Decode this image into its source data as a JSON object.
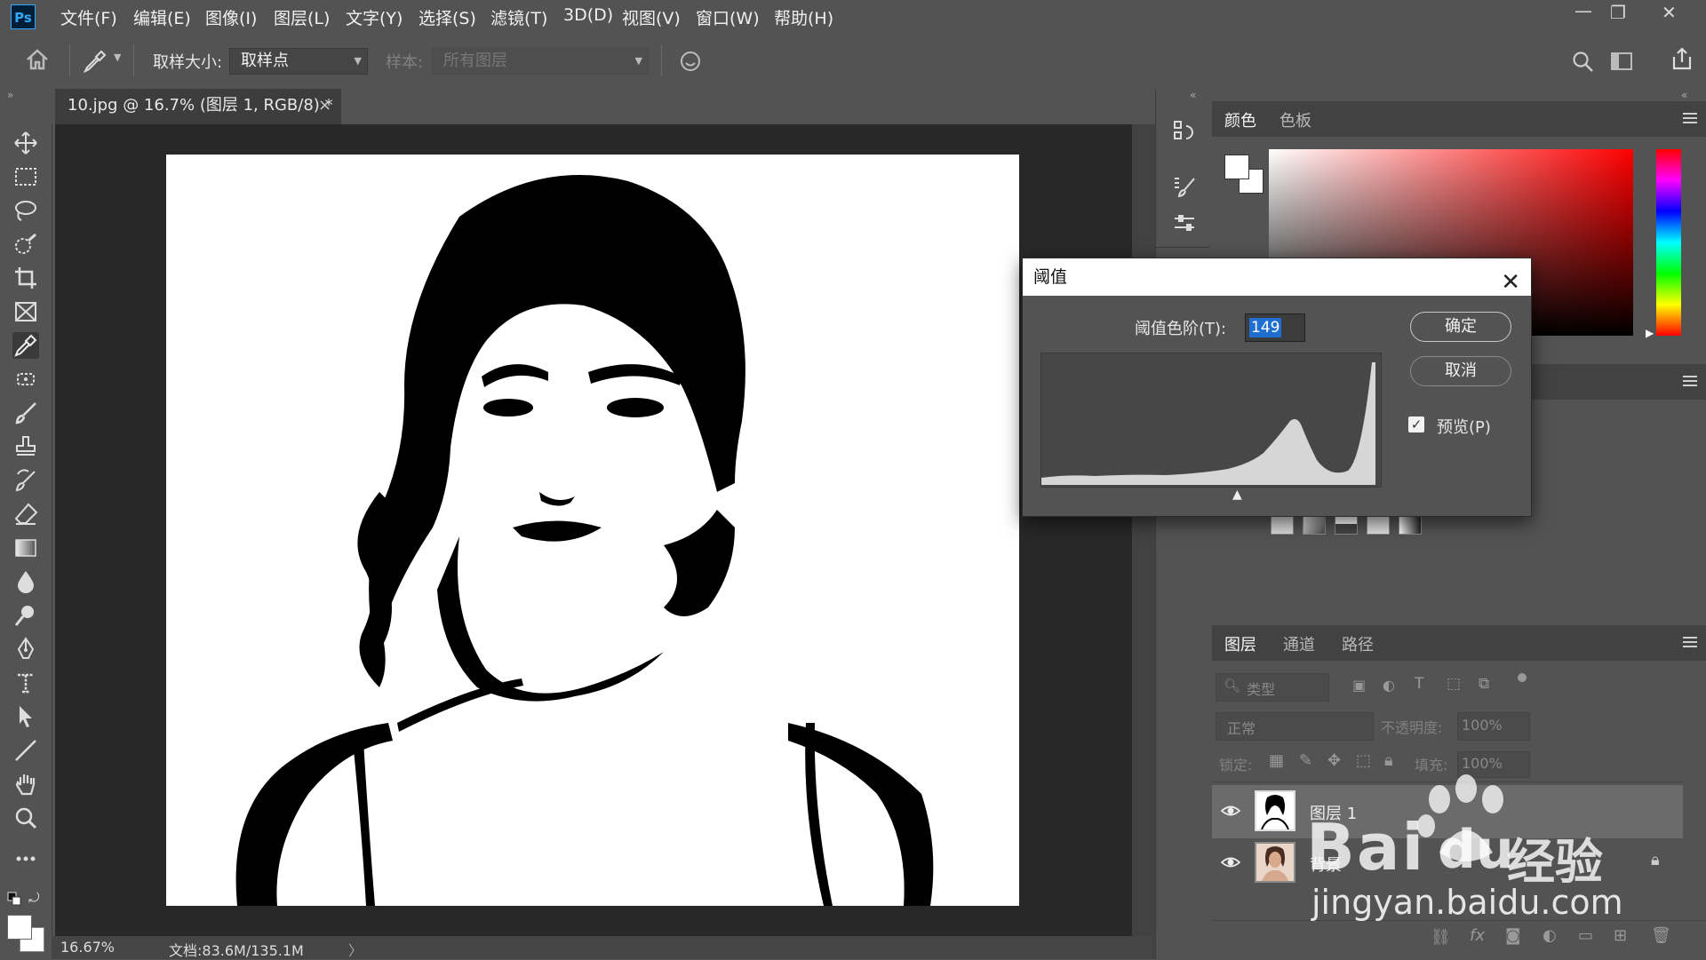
{
  "app": {
    "logo": "Ps",
    "menu": [
      "文件(F)",
      "编辑(E)",
      "图像(I)",
      "图层(L)",
      "文字(Y)",
      "选择(S)",
      "滤镜(T)",
      "3D(D)",
      "视图(V)",
      "窗口(W)",
      "帮助(H)"
    ],
    "window_controls": [
      "minimize-icon",
      "restore-icon",
      "close-icon"
    ]
  },
  "options_bar": {
    "sample_size_label": "取样大小:",
    "sample_size_value": "取样点",
    "sample_label": "样本:",
    "sample_value": "所有图层"
  },
  "document": {
    "tab_title": "10.jpg @ 16.7% (图层 1, RGB/8) *",
    "zoom": "16.67%",
    "doc_info": "文档:83.6M/135.1M"
  },
  "color_panel": {
    "tabs": [
      "颜色",
      "色板"
    ],
    "active_tab": "颜色",
    "hue_gradient_top": "#ff0000"
  },
  "threshold_dialog": {
    "title": "阈值",
    "level_label": "阈值色阶(T):",
    "level_value": "149",
    "ok_label": "确定",
    "cancel_label": "取消",
    "preview_label": "预览(P)",
    "preview_checked": true,
    "histogram_slider_value": 149
  },
  "layers_panel": {
    "tabs": [
      "图层",
      "通道",
      "路径"
    ],
    "active_tab": "图层",
    "filter_placeholder": "类型",
    "blend_mode": "正常",
    "opacity_label": "不透明度:",
    "opacity_value": "100%",
    "lock_label": "锁定:",
    "fill_label": "填充:",
    "fill_value": "100%",
    "layers": [
      {
        "name": "图层 1",
        "visible": true,
        "selected": true
      },
      {
        "name": "背景",
        "visible": true,
        "locked": true
      }
    ]
  },
  "watermark": {
    "brand": "Bai",
    "suffix": "经验",
    "url": "jingyan.baidu.com"
  }
}
